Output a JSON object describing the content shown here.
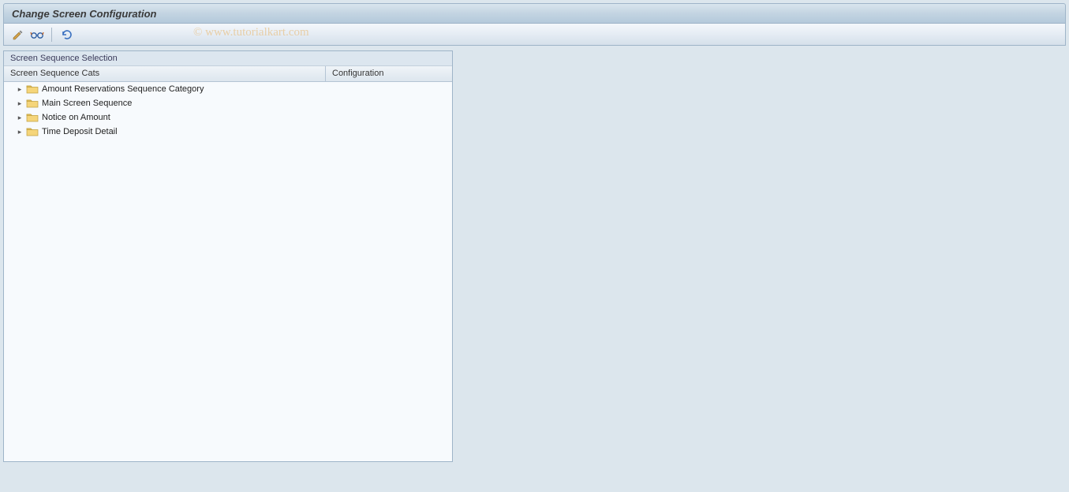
{
  "title": "Change Screen Configuration",
  "watermark": "© www.tutorialkart.com",
  "panel": {
    "title": "Screen Sequence Selection",
    "columns": {
      "col1": "Screen Sequence Cats",
      "col2": "Configuration"
    },
    "items": [
      {
        "label": "Amount Reservations Sequence Category"
      },
      {
        "label": "Main Screen Sequence"
      },
      {
        "label": "Notice on Amount"
      },
      {
        "label": "Time Deposit Detail"
      }
    ]
  }
}
